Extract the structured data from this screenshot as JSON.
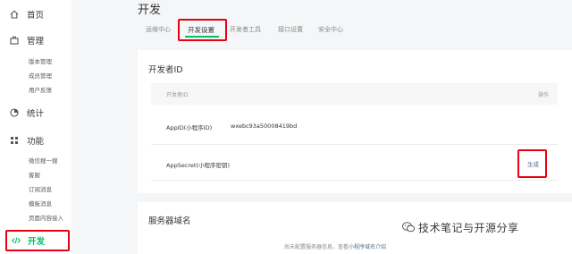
{
  "sidebar": {
    "home": {
      "label": "首页",
      "icon": "home-icon"
    },
    "manage": {
      "label": "管理",
      "icon": "briefcase-icon",
      "items": [
        "版本管理",
        "成员管理",
        "用户反馈"
      ]
    },
    "stats": {
      "label": "统计",
      "icon": "pie-chart-icon"
    },
    "features": {
      "label": "功能",
      "icon": "grid-icon",
      "items": [
        "微信搜一搜",
        "客服",
        "订阅消息",
        "模板消息",
        "页面内容接入"
      ]
    },
    "develop": {
      "label": "开发",
      "icon": "code-icon"
    }
  },
  "header": {
    "title": "开发",
    "tabs": [
      {
        "label": "运维中心",
        "active": false
      },
      {
        "label": "开发设置",
        "active": true
      },
      {
        "label": "开发者工具",
        "active": false
      },
      {
        "label": "接口设置",
        "active": false
      },
      {
        "label": "安全中心",
        "active": false
      }
    ]
  },
  "developer_id": {
    "title": "开发者ID",
    "columns": [
      "开发者ID",
      "操作"
    ],
    "rows": [
      {
        "label": "AppID(小程序ID)",
        "value": "wxebc93a50008419bd",
        "action": ""
      },
      {
        "label": "AppSecret(小程序密钥)",
        "value": "",
        "action": "生成"
      }
    ]
  },
  "server_domain": {
    "title": "服务器域名",
    "note": "尚未配置服务器信息，查看",
    "note_link": "小程序域名介绍"
  },
  "watermark": {
    "text": "技术笔记与开源分享",
    "icon": "wechat-icon"
  },
  "colors": {
    "accent": "#07c160",
    "highlight": "#e60012",
    "link": "#576b95"
  }
}
